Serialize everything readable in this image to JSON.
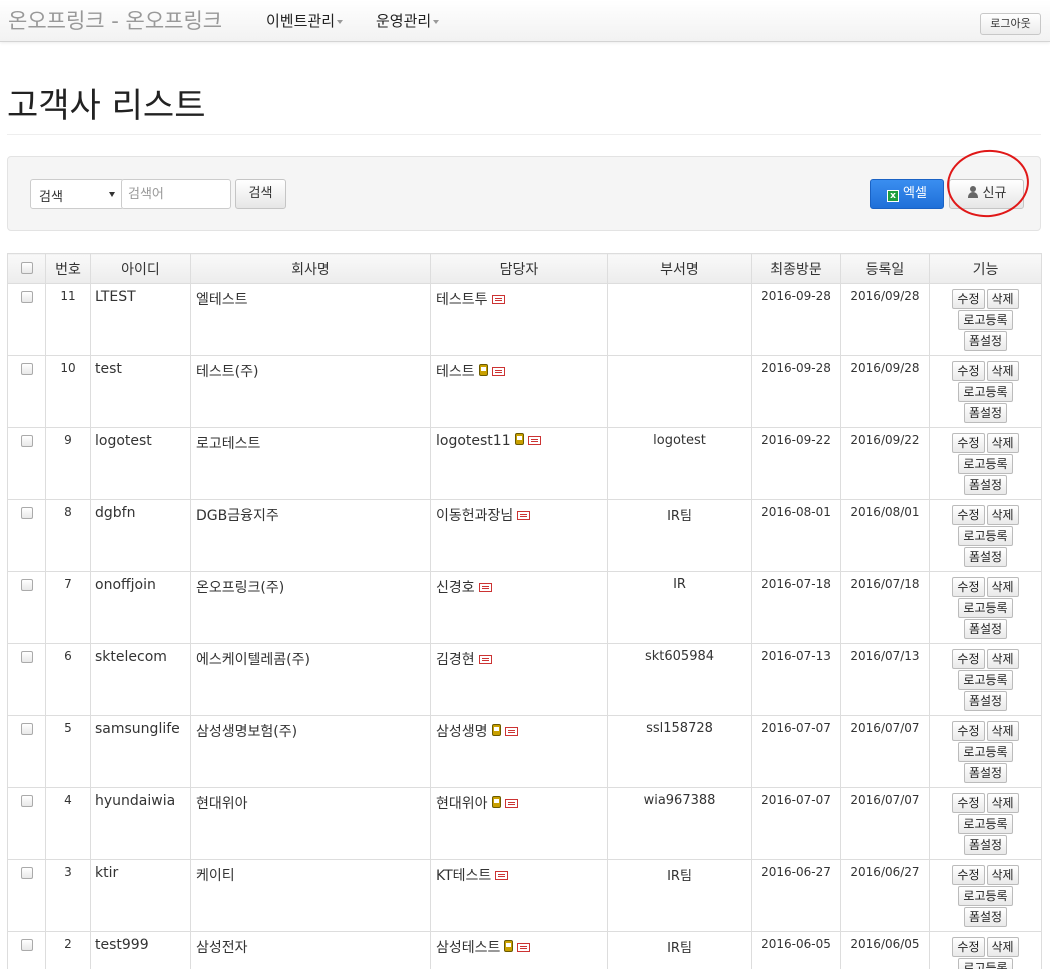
{
  "navbar": {
    "brand": "온오프링크 - 온오프링크",
    "menus": [
      "이벤트관리",
      "운영관리"
    ],
    "logout_label": "로그아웃"
  },
  "page_title": "고객사 리스트",
  "toolbar": {
    "search_select": "검색",
    "search_placeholder": "검색어",
    "search_button": "검색",
    "excel_button": "엑셀",
    "new_button": "신규"
  },
  "table": {
    "headers": [
      "번호",
      "아이디",
      "회사명",
      "담당자",
      "부서명",
      "최종방문",
      "등록일",
      "기능"
    ],
    "actions": {
      "edit": "수정",
      "delete": "삭제",
      "logo": "로고등록",
      "form": "폼설정"
    },
    "rows": [
      {
        "no": "11",
        "id": "LTEST",
        "company": "엘테스트",
        "manager": "테스트투",
        "mobile": false,
        "dept": "",
        "last_visit": "2016-09-28",
        "registered": "2016/09/28"
      },
      {
        "no": "10",
        "id": "test",
        "company": "테스트(주)",
        "manager": "테스트",
        "mobile": true,
        "dept": "",
        "last_visit": "2016-09-28",
        "registered": "2016/09/28"
      },
      {
        "no": "9",
        "id": "logotest",
        "company": "로고테스트",
        "manager": "logotest11",
        "mobile": true,
        "dept": "logotest",
        "last_visit": "2016-09-22",
        "registered": "2016/09/22"
      },
      {
        "no": "8",
        "id": "dgbfn",
        "company": "DGB금융지주",
        "manager": "이동헌과장님",
        "mobile": false,
        "dept": "IR팀",
        "last_visit": "2016-08-01",
        "registered": "2016/08/01"
      },
      {
        "no": "7",
        "id": "onoffjoin",
        "company": "온오프링크(주)",
        "manager": "신경호",
        "mobile": false,
        "dept": "IR",
        "last_visit": "2016-07-18",
        "registered": "2016/07/18"
      },
      {
        "no": "6",
        "id": "sktelecom",
        "company": "에스케이텔레콤(주)",
        "manager": "김경현",
        "mobile": false,
        "dept": "skt605984",
        "last_visit": "2016-07-13",
        "registered": "2016/07/13"
      },
      {
        "no": "5",
        "id": "samsunglife",
        "company": "삼성생명보험(주)",
        "manager": "삼성생명",
        "mobile": true,
        "dept": "ssl158728",
        "last_visit": "2016-07-07",
        "registered": "2016/07/07"
      },
      {
        "no": "4",
        "id": "hyundaiwia",
        "company": "현대위아",
        "manager": "현대위아",
        "mobile": true,
        "dept": "wia967388",
        "last_visit": "2016-07-07",
        "registered": "2016/07/07"
      },
      {
        "no": "3",
        "id": "ktir",
        "company": "케이티",
        "manager": "KT테스트",
        "mobile": false,
        "dept": "IR팀",
        "last_visit": "2016-06-27",
        "registered": "2016/06/27"
      },
      {
        "no": "2",
        "id": "test999",
        "company": "삼성전자",
        "manager": "삼성테스트",
        "mobile": true,
        "dept": "IR팀",
        "last_visit": "2016-06-05",
        "registered": "2016/06/05"
      }
    ]
  },
  "colors": {
    "link": "#2a6fc9",
    "excel": "#2a7fe6",
    "annotation": "#e01818"
  }
}
